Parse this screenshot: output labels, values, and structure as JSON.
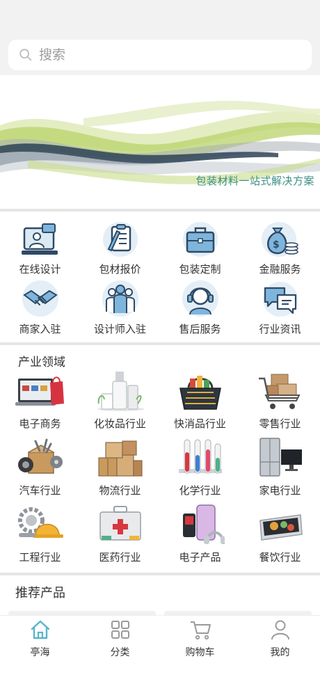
{
  "search": {
    "placeholder": "搜索"
  },
  "banner": {
    "slogan": "包装材料一站式解决方案"
  },
  "services": [
    {
      "label": "在线设计",
      "icon": "online-design-icon"
    },
    {
      "label": "包材报价",
      "icon": "quote-clipboard-icon"
    },
    {
      "label": "包装定制",
      "icon": "briefcase-icon"
    },
    {
      "label": "金融服务",
      "icon": "money-bag-icon"
    },
    {
      "label": "商家入驻",
      "icon": "handshake-icon"
    },
    {
      "label": "设计师入驻",
      "icon": "designers-group-icon"
    },
    {
      "label": "售后服务",
      "icon": "headset-agent-icon"
    },
    {
      "label": "行业资讯",
      "icon": "chat-bubbles-icon"
    }
  ],
  "industry": {
    "title": "产业领域",
    "items": [
      {
        "label": "电子商务"
      },
      {
        "label": "化妆品行业"
      },
      {
        "label": "快消品行业"
      },
      {
        "label": "零售行业"
      },
      {
        "label": "汽车行业"
      },
      {
        "label": "物流行业"
      },
      {
        "label": "化学行业"
      },
      {
        "label": "家电行业"
      },
      {
        "label": "工程行业"
      },
      {
        "label": "医药行业"
      },
      {
        "label": "电子产品"
      },
      {
        "label": "餐饮行业"
      }
    ]
  },
  "recommend": {
    "title": "推荐产品"
  },
  "tabbar": [
    {
      "label": "亭海",
      "icon": "home-icon",
      "active": true
    },
    {
      "label": "分类",
      "icon": "category-grid-icon"
    },
    {
      "label": "购物车",
      "icon": "cart-icon"
    },
    {
      "label": "我的",
      "icon": "user-icon"
    }
  ],
  "colors": {
    "accent": "#5bb3c9",
    "banner_green": "#b9d36a",
    "slogan": "#3c8f86"
  }
}
